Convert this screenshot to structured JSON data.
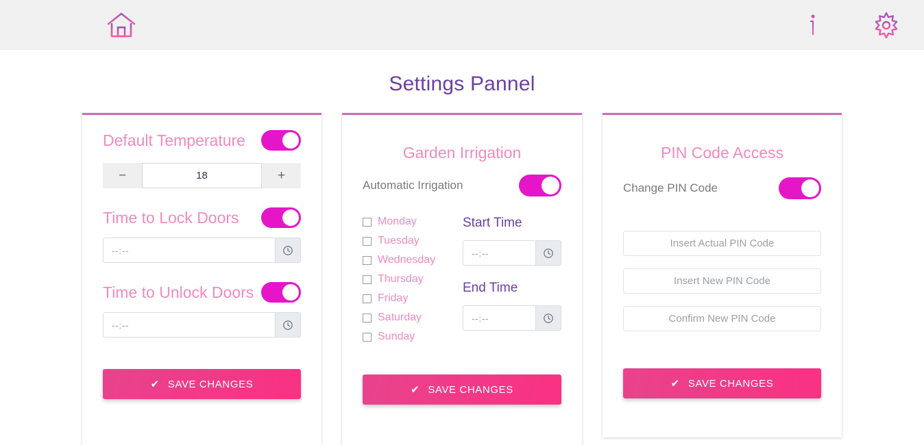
{
  "header": {
    "menu_icon": "hamburger-menu-icon",
    "home_icon": "home-icon",
    "info_icon": "info-icon",
    "settings_icon": "gear-icon"
  },
  "page": {
    "title": "Settings Pannel"
  },
  "colors": {
    "accent_pink": "#EF8BC0",
    "toggle_on": "#E516C8",
    "title_purple": "#6B3FA0",
    "card_top_border": "#CC6DB5",
    "save_gradient_start": "#E8438C",
    "save_gradient_end": "#FA3183"
  },
  "card_temperature": {
    "temperature_label": "Default Temperature",
    "temperature_toggle": "on",
    "stepper": {
      "decrement": "−",
      "value": "18",
      "increment": "+"
    },
    "lock_label": "Time to Lock Doors",
    "lock_toggle": "on",
    "lock_time_value": "--:--",
    "lock_clock_icon": "clock-icon",
    "unlock_label": "Time to Unlock Doors",
    "unlock_toggle": "on",
    "unlock_time_value": "--:--",
    "unlock_clock_icon": "clock-icon",
    "save_label": "SAVE CHANGES",
    "save_icon": "check-icon"
  },
  "card_irrigation": {
    "title": "Garden Irrigation",
    "automatic_label": "Automatic Irrigation",
    "automatic_toggle": "on",
    "days": [
      {
        "label": "Monday",
        "checked": false
      },
      {
        "label": "Tuesday",
        "checked": false
      },
      {
        "label": "Wednesday",
        "checked": false
      },
      {
        "label": "Thursday",
        "checked": false
      },
      {
        "label": "Friday",
        "checked": false
      },
      {
        "label": "Saturday",
        "checked": false
      },
      {
        "label": "Sunday",
        "checked": false
      }
    ],
    "start_time_label": "Start Time",
    "start_time_value": "--:--",
    "start_clock_icon": "clock-icon",
    "end_time_label": "End Time",
    "end_time_value": "--:--",
    "end_clock_icon": "clock-icon",
    "save_label": "SAVE CHANGES",
    "save_icon": "check-icon"
  },
  "card_pin": {
    "title": "PIN Code Access",
    "change_label": "Change PIN Code",
    "change_toggle": "on",
    "actual_pin_placeholder": "Insert Actual PIN Code",
    "new_pin_placeholder": "Insert New PIN Code",
    "confirm_pin_placeholder": "Confirm New PIN Code",
    "save_label": "SAVE CHANGES",
    "save_icon": "check-icon"
  }
}
